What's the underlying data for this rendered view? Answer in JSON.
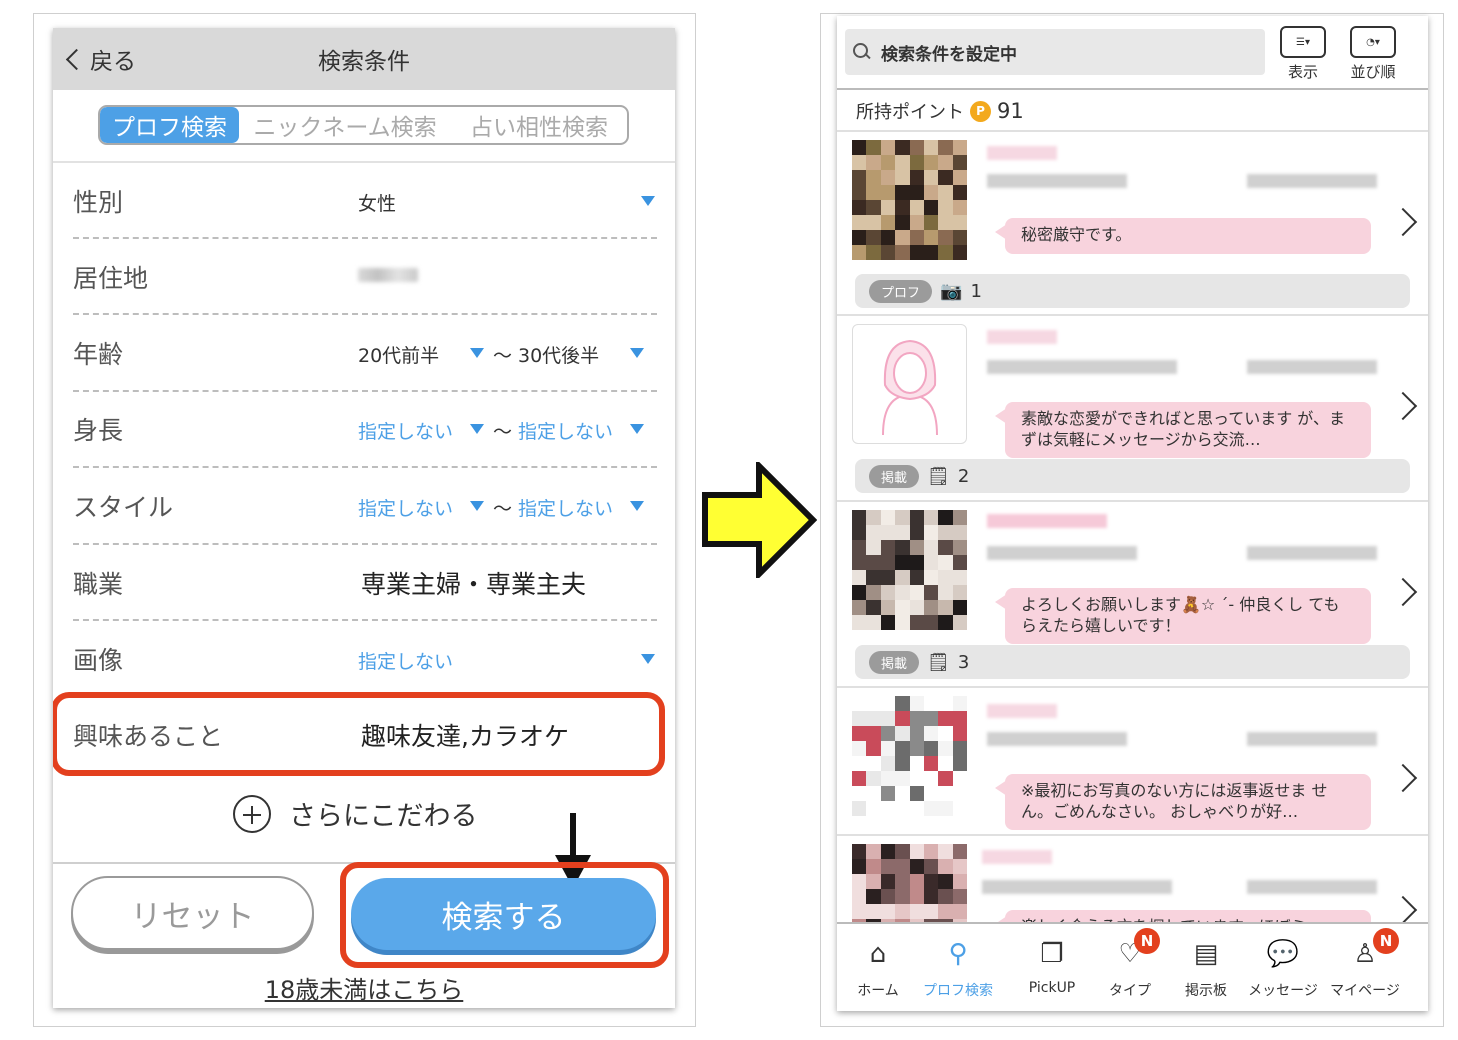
{
  "left": {
    "back_label": "戻る",
    "title": "検索条件",
    "tabs": [
      "プロフ検索",
      "ニックネーム検索",
      "占い相性検索"
    ],
    "rows": {
      "gender": {
        "label": "性別",
        "value": "女性"
      },
      "residence": {
        "label": "居住地"
      },
      "age": {
        "label": "年齢",
        "from": "20代前半",
        "sep": "〜",
        "to": "30代後半"
      },
      "height": {
        "label": "身長",
        "from": "指定しない",
        "sep": "〜",
        "to": "指定しない"
      },
      "style": {
        "label": "スタイル",
        "from": "指定しない",
        "sep": "〜",
        "to": "指定しない"
      },
      "job": {
        "label": "職業",
        "value": "専業主婦・専業主夫"
      },
      "image": {
        "label": "画像",
        "value": "指定しない"
      },
      "interests": {
        "label": "興味あること",
        "value": "趣味友達,カラオケ"
      }
    },
    "more_label": "さらにこだわる",
    "reset_label": "リセット",
    "search_label": "検索する",
    "under18_label": "18歳未満はこちら"
  },
  "right": {
    "search_text": "検索条件を設定中",
    "display_label": "表示",
    "sort_label": "並び順",
    "points_label": "所持ポイント",
    "points_coin": "P",
    "points_value": "91",
    "cards": [
      {
        "message": "秘密厳守です。",
        "tag": "プロフ",
        "count_icon": "camera-icon",
        "count": "1"
      },
      {
        "message": "素敵な恋愛ができればと思っています が、まずは気軽にメッセージから交流…",
        "tag": "掲載",
        "count_icon": "board-icon",
        "count": "2"
      },
      {
        "message": "よろしくお願いします🧸☆ ´- 仲良くし てもらえたら嬉しいです！",
        "tag": "掲載",
        "count_icon": "board-icon",
        "count": "3"
      },
      {
        "message": "※最初にお写真のない方には返事返せま せん。ごめんなさい。 おしゃべりが好…"
      },
      {
        "message": "楽しく会える方を探しています。ほぼミ"
      }
    ],
    "tabs": [
      {
        "label": "ホーム",
        "icon": "home-icon"
      },
      {
        "label": "プロフ検索",
        "icon": "search-icon"
      },
      {
        "label": "PickUP",
        "icon": "pickup-icon"
      },
      {
        "label": "タイプ",
        "icon": "heart-icon",
        "badge": "N"
      },
      {
        "label": "掲示板",
        "icon": "board-icon"
      },
      {
        "label": "メッセージ",
        "icon": "chat-icon"
      },
      {
        "label": "マイページ",
        "icon": "person-icon",
        "badge": "N"
      }
    ]
  },
  "colors": {
    "accent": "#4da0e6",
    "highlight": "#e3401e",
    "bubble": "#f8d3dd",
    "arrow": "#ffff33"
  }
}
